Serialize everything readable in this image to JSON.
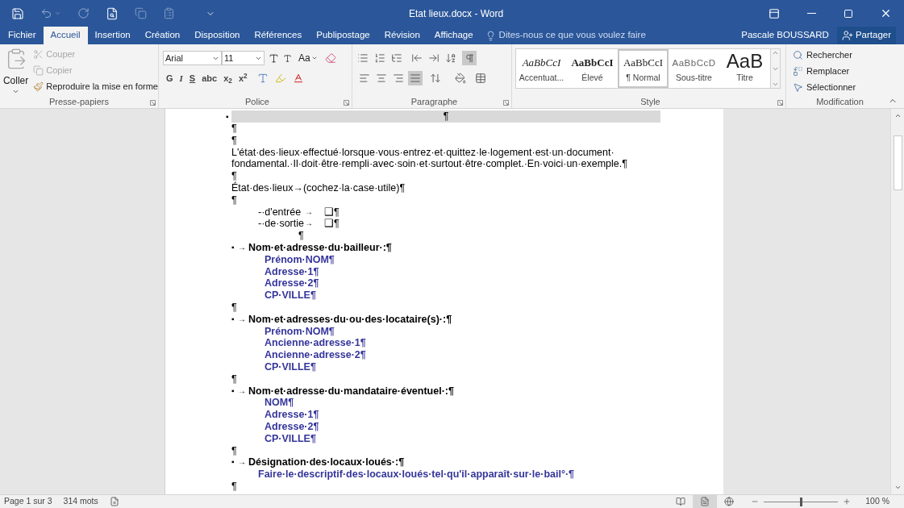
{
  "window": {
    "title": "Etat lieux.docx - Word"
  },
  "tabs": [
    {
      "label": "Fichier",
      "selected": false
    },
    {
      "label": "Accueil",
      "selected": true
    },
    {
      "label": "Insertion",
      "selected": false
    },
    {
      "label": "Création",
      "selected": false
    },
    {
      "label": "Disposition",
      "selected": false
    },
    {
      "label": "Références",
      "selected": false
    },
    {
      "label": "Publipostage",
      "selected": false
    },
    {
      "label": "Révision",
      "selected": false
    },
    {
      "label": "Affichage",
      "selected": false
    }
  ],
  "tell_me": "Dites-nous ce que vous voulez faire",
  "user": "Pascale BOUSSARD",
  "share": "Partager",
  "clipboard": {
    "label": "Presse-papiers",
    "paste": "Coller",
    "actions": [
      {
        "label": "Couper",
        "kind": "cut",
        "disabled": true
      },
      {
        "label": "Copier",
        "kind": "copy",
        "disabled": true
      },
      {
        "label": "Reproduire la mise en forme",
        "kind": "painter",
        "disabled": false
      }
    ]
  },
  "font": {
    "label": "Police",
    "name": "Arial",
    "size": "11",
    "case_button": "Aa",
    "format_buttons": [
      "G",
      "I",
      "S",
      "abc",
      "x$_{2}$",
      "x$^{2}$"
    ]
  },
  "paragraph": {
    "label": "Paragraphe",
    "show_marks": true,
    "alignments": [
      {
        "kind": "left",
        "selected": false
      },
      {
        "kind": "center",
        "selected": false
      },
      {
        "kind": "right",
        "selected": false
      },
      {
        "kind": "justify",
        "selected": true
      }
    ]
  },
  "styles": {
    "label": "Style",
    "items": [
      {
        "preview": "AaBbCcI",
        "name": "Accentuat...",
        "kind": "emphasis",
        "selected": false
      },
      {
        "preview": "AaBbCcI",
        "name": "Élevé",
        "kind": "strong",
        "selected": false
      },
      {
        "preview": "AaBbCcI",
        "name": "¶ Normal",
        "kind": "normal",
        "selected": true
      },
      {
        "preview": "AaBbCcD",
        "name": "Sous-titre",
        "kind": "subtitle",
        "selected": false
      },
      {
        "preview": "AaB",
        "name": "Titre",
        "kind": "title",
        "selected": false
      }
    ]
  },
  "editing": {
    "label": "Modification",
    "items": [
      {
        "label": "Rechercher",
        "kind": "find"
      },
      {
        "label": "Remplacer",
        "kind": "replace"
      },
      {
        "label": "Sélectionner",
        "kind": "select"
      }
    ]
  },
  "document": {
    "lines": [
      {
        "kind": "shaded",
        "bullet": "▪",
        "text": "¶"
      },
      {
        "kind": "plain",
        "text": "¶"
      },
      {
        "kind": "plain",
        "text": "¶"
      },
      {
        "kind": "plain",
        "text": "L'état·des·lieux·effectué·lorsque·vous·entrez·et·quittez·le·logement·est·un·document·"
      },
      {
        "kind": "plain",
        "text": "fondamental.·Il·doit·être·rempli·avec·soin·et·surtout·être·complet.·En·voici·un·exemple.¶"
      },
      {
        "kind": "plain",
        "text": "¶"
      },
      {
        "kind": "plain",
        "text": "État·des·lieux→(cochez·la·case·utile)¶"
      },
      {
        "kind": "plain",
        "text": "¶"
      },
      {
        "kind": "choice",
        "label": "-·d'entrée",
        "arrow": "→",
        "box": "❑¶"
      },
      {
        "kind": "choice",
        "label": "-·de·sortie",
        "arrow": "→",
        "box": "❑¶"
      },
      {
        "kind": "centered",
        "text": "¶"
      },
      {
        "kind": "heading",
        "bullet": "▪",
        "arrow": "→",
        "text": "Nom·et·adresse·du·bailleur·:¶"
      },
      {
        "kind": "detail",
        "text": "Prénom·NOM¶"
      },
      {
        "kind": "detail",
        "text": "Adresse·1¶"
      },
      {
        "kind": "detail",
        "text": "Adresse·2¶"
      },
      {
        "kind": "detail",
        "text": "CP·VILLE¶"
      },
      {
        "kind": "plain",
        "text": "¶"
      },
      {
        "kind": "heading",
        "bullet": "▪",
        "arrow": "→",
        "text": "Nom·et·adresses·du·ou·des·locataire(s)·:¶"
      },
      {
        "kind": "detail",
        "text": "Prénom·NOM¶"
      },
      {
        "kind": "detail",
        "text": "Ancienne·adresse·1¶"
      },
      {
        "kind": "detail",
        "text": "Ancienne·adresse·2¶"
      },
      {
        "kind": "detail",
        "text": "CP·VILLE¶"
      },
      {
        "kind": "plain",
        "text": "¶"
      },
      {
        "kind": "heading",
        "bullet": "▪",
        "arrow": "→",
        "text": "Nom·et·adresse·du·mandataire·éventuel·:¶"
      },
      {
        "kind": "detail",
        "text": "NOM¶"
      },
      {
        "kind": "detail",
        "text": "Adresse·1¶"
      },
      {
        "kind": "detail",
        "text": "Adresse·2¶"
      },
      {
        "kind": "detail",
        "text": "CP·VILLE¶"
      },
      {
        "kind": "plain",
        "text": "¶"
      },
      {
        "kind": "heading",
        "bullet": "▪",
        "arrow": "→",
        "text": "Désignation·des·locaux·loués·:¶"
      },
      {
        "kind": "note",
        "text": "Faire·le·descriptif·des·locaux·loués·tel·qu'il·apparaît·sur·le·bail°·¶"
      },
      {
        "kind": "plain",
        "text": "¶"
      }
    ]
  },
  "status_bar": {
    "page": "Page 1 sur 3",
    "words": "314 mots",
    "views": [
      {
        "kind": "read",
        "selected": false
      },
      {
        "kind": "print",
        "selected": true
      },
      {
        "kind": "web",
        "selected": false
      }
    ],
    "zoom_slider": {
      "level": 0.5
    },
    "zoom": "100 %"
  }
}
